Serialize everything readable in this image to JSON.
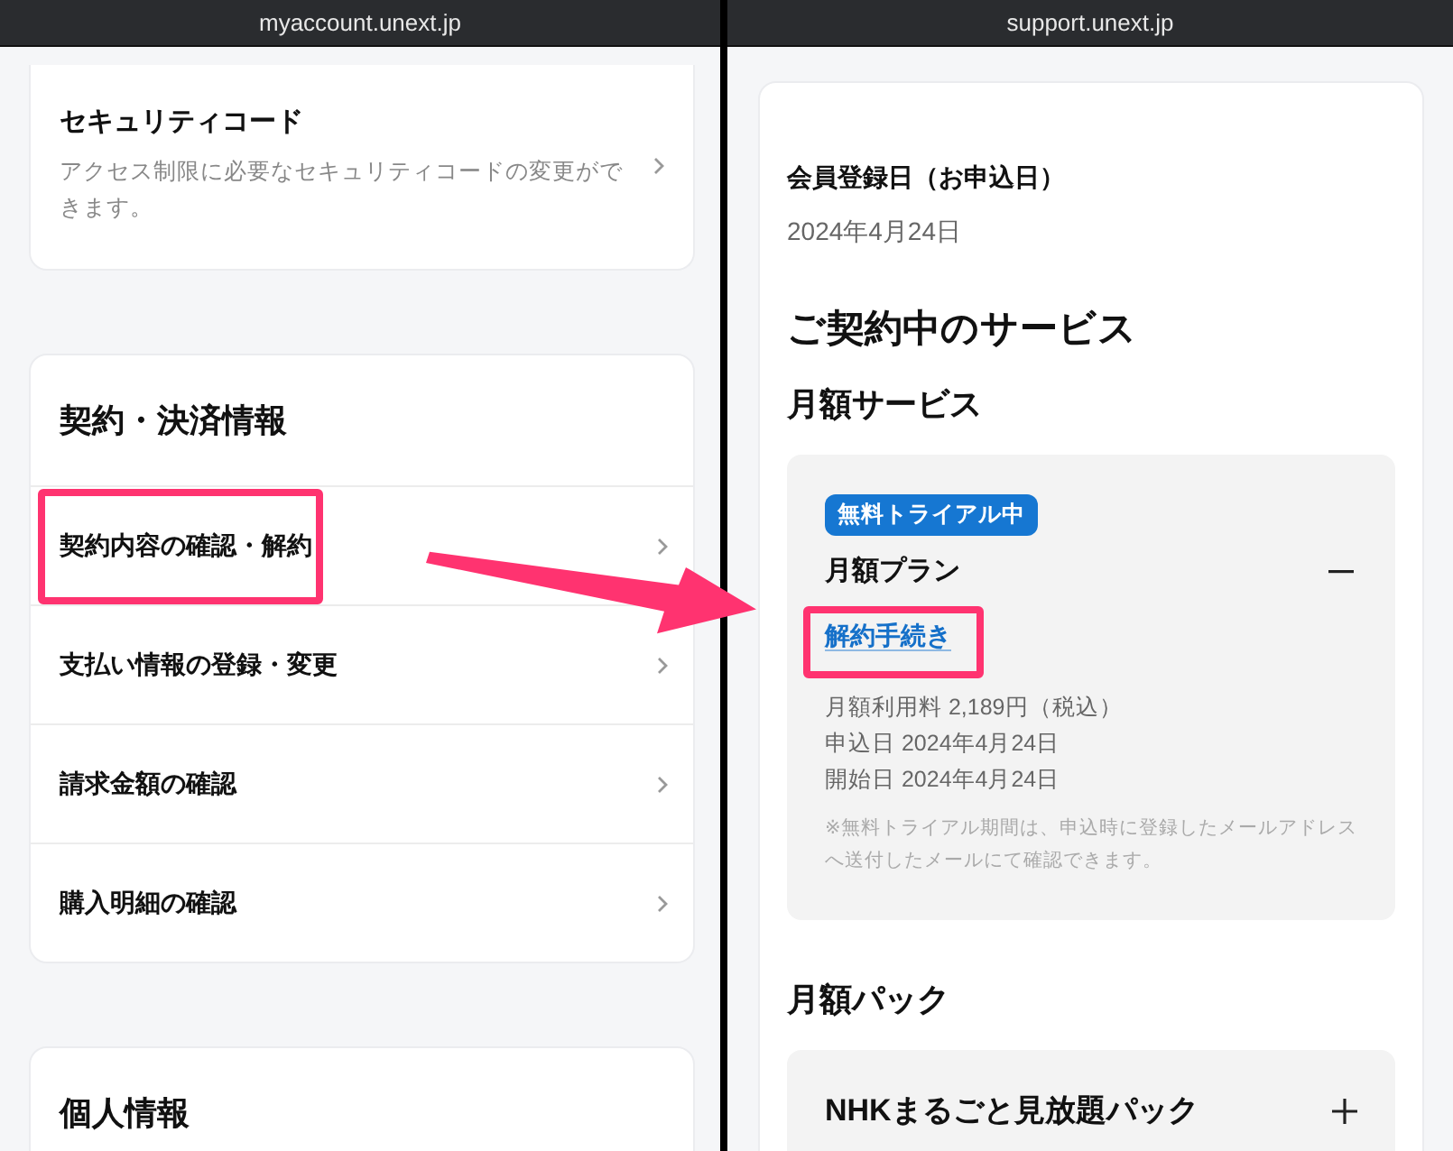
{
  "left_window": {
    "url": "myaccount.unext.jp",
    "security_card": {
      "title": "セキュリティコード",
      "description": "アクセス制限に必要なセキュリティコードの変更ができます。"
    },
    "contract_card": {
      "title": "契約・決済情報",
      "items": [
        {
          "label": "契約内容の確認・解約",
          "highlighted": true
        },
        {
          "label": "支払い情報の登録・変更",
          "highlighted": false
        },
        {
          "label": "請求金額の確認",
          "highlighted": false
        },
        {
          "label": "購入明細の確認",
          "highlighted": false
        }
      ]
    },
    "personal_card": {
      "title": "個人情報"
    }
  },
  "right_window": {
    "url": "support.unext.jp",
    "registration_label": "会員登録日（お申込日）",
    "registration_date": "2024年4月24日",
    "section_title": "ご契約中のサービス",
    "monthly_service": {
      "title": "月額サービス",
      "plan": {
        "badge": "無料トライアル中",
        "name": "月額プラン",
        "expanded": true,
        "cancel_link": "解約手続き",
        "cancel_highlighted": true,
        "details": [
          "月額利用料 2,189円（税込）",
          "申込日 2024年4月24日",
          "開始日 2024年4月24日"
        ],
        "note": "※無料トライアル期間は、申込時に登録したメールアドレスへ送付したメールにて確認できます。"
      }
    },
    "monthly_pack": {
      "title": "月額パック",
      "pack": {
        "name": "NHKまるごと見放題パック",
        "expanded": false
      }
    }
  }
}
